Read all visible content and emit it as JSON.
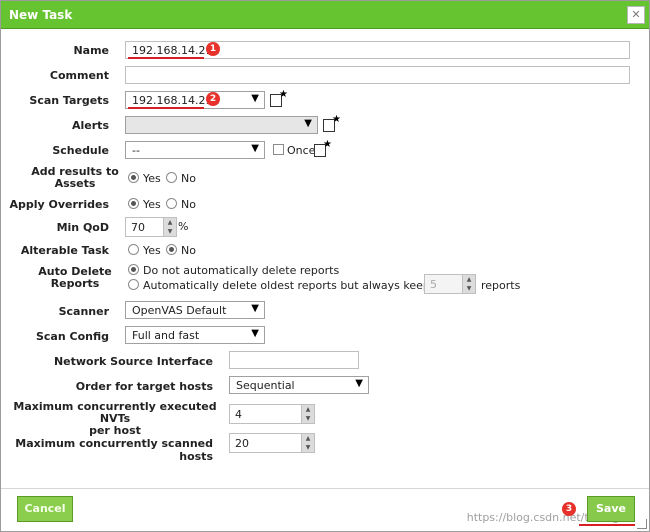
{
  "dialog": {
    "title": "New Task",
    "close_icon": "close-icon"
  },
  "fields": {
    "name": {
      "label": "Name",
      "value": "192.168.14.211"
    },
    "comment": {
      "label": "Comment",
      "value": ""
    },
    "scan_targets": {
      "label": "Scan Targets",
      "value": "192.168.14.211"
    },
    "alerts": {
      "label": "Alerts",
      "value": ""
    },
    "schedule": {
      "label": "Schedule",
      "value": "--",
      "once_label": "Once"
    },
    "add_results": {
      "label_line1": "Add results to",
      "label_line2": "Assets",
      "yes": "Yes",
      "no": "No",
      "selected": "yes"
    },
    "apply_overrides": {
      "label": "Apply Overrides",
      "yes": "Yes",
      "no": "No",
      "selected": "yes"
    },
    "min_qod": {
      "label": "Min QoD",
      "value": "70",
      "unit": "%"
    },
    "alterable_task": {
      "label": "Alterable Task",
      "yes": "Yes",
      "no": "No",
      "selected": "no"
    },
    "auto_delete": {
      "label_line1": "Auto Delete",
      "label_line2": "Reports",
      "option1": "Do not automatically delete reports",
      "option2": "Automatically delete oldest reports but always keep newest",
      "keep_value": "5",
      "suffix": "reports",
      "selected": "option1"
    },
    "scanner": {
      "label": "Scanner",
      "value": "OpenVAS Default"
    },
    "scan_config": {
      "label": "Scan Config",
      "value": "Full and fast"
    },
    "network_source_interface": {
      "label": "Network Source Interface",
      "value": ""
    },
    "order_hosts": {
      "label": "Order for target hosts",
      "value": "Sequential"
    },
    "max_nvts": {
      "label_line1": "Maximum concurrently executed NVTs",
      "label_line2": "per host",
      "value": "4"
    },
    "max_hosts": {
      "label": "Maximum concurrently scanned hosts",
      "value": "20"
    }
  },
  "annotations": {
    "badge1": "1",
    "badge2": "2",
    "badge3": "3"
  },
  "footer": {
    "cancel_label": "Cancel",
    "save_label": "Save",
    "watermark": "https://blog.csdn.net/tladagio"
  },
  "colors": {
    "titlebar": "#66c430",
    "button": "#87c94a",
    "annotation_red": "#d81f26"
  }
}
